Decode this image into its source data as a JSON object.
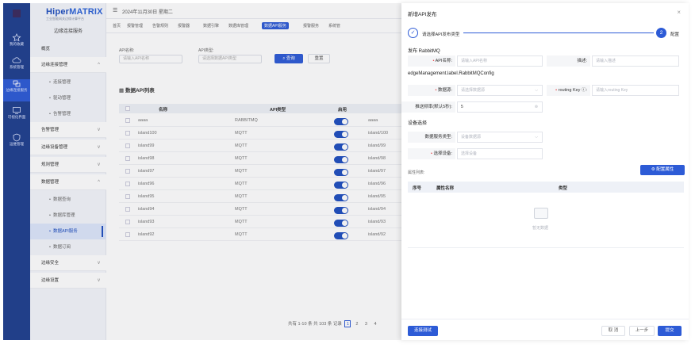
{
  "rail": {
    "items": [
      {
        "label": "我的收藏",
        "icon": "star-icon"
      },
      {
        "label": "系统管理",
        "icon": "cloud-icon"
      },
      {
        "label": "边缘连接服务",
        "icon": "link-icon"
      },
      {
        "label": "可视化界面",
        "icon": "monitor-icon"
      },
      {
        "label": "运维管理",
        "icon": "shield-icon"
      }
    ]
  },
  "brand": {
    "name_prefix": "Hiper",
    "name_suffix": "MATRIX",
    "subtitle": "工业智能网关边缘计算平台"
  },
  "sidebar": {
    "header": "边缘连接服务",
    "items": [
      {
        "label": "概览",
        "type": "plain"
      },
      {
        "label": "边缘连接管理",
        "type": "group",
        "chevron": "^"
      },
      {
        "label": "连接管理",
        "type": "sub"
      },
      {
        "label": "驱动管理",
        "type": "sub"
      },
      {
        "label": "告警管理",
        "type": "sub"
      },
      {
        "label": "告警管理",
        "type": "group",
        "chevron": "v"
      },
      {
        "label": "边缘设备管理",
        "type": "group",
        "chevron": "v"
      },
      {
        "label": "规则管理",
        "type": "group",
        "chevron": "v"
      },
      {
        "label": "数据管理",
        "type": "group",
        "chevron": "^"
      },
      {
        "label": "数据查询",
        "type": "sub"
      },
      {
        "label": "数据库管理",
        "type": "sub"
      },
      {
        "label": "数据API服务",
        "type": "sub",
        "current": true
      },
      {
        "label": "数据订阅",
        "type": "sub"
      },
      {
        "label": "边缘安全",
        "type": "group",
        "chevron": "v"
      },
      {
        "label": "边缘设置",
        "type": "group",
        "chevron": "v"
      }
    ]
  },
  "topbar": {
    "date": "2024年11月30日 星期二"
  },
  "tabs": [
    {
      "label": "首页"
    },
    {
      "label": "报警管理"
    },
    {
      "label": "告警规则"
    },
    {
      "label": "报警器"
    },
    {
      "label": "数据引擎"
    },
    {
      "label": "数据库管理"
    },
    {
      "label": "数据API服务",
      "active": true
    },
    {
      "label": "报警服务"
    },
    {
      "label": "系统管"
    }
  ],
  "filter": {
    "name_label": "API名称:",
    "name_placeholder": "请输入API名称",
    "type_label": "API类型:",
    "type_placeholder": "请选择数据API类型",
    "search_label": "查询",
    "reset_label": "重置"
  },
  "list": {
    "title": "数据API列表",
    "columns": [
      "名称",
      "API类型",
      "启用"
    ],
    "rows": [
      {
        "name": "aaaa",
        "type": "RABBITMQ",
        "extra": "aaaa"
      },
      {
        "name": "island100",
        "type": "MQTT",
        "extra": "island/100"
      },
      {
        "name": "island99",
        "type": "MQTT",
        "extra": "island/99"
      },
      {
        "name": "island98",
        "type": "MQTT",
        "extra": "island/98"
      },
      {
        "name": "island97",
        "type": "MQTT",
        "extra": "island/97"
      },
      {
        "name": "island96",
        "type": "MQTT",
        "extra": "island/96"
      },
      {
        "name": "island95",
        "type": "MQTT",
        "extra": "island/95"
      },
      {
        "name": "island94",
        "type": "MQTT",
        "extra": "island/94"
      },
      {
        "name": "island93",
        "type": "MQTT",
        "extra": "island/93"
      },
      {
        "name": "island92",
        "type": "MQTT",
        "extra": "island/92"
      }
    ],
    "pager_text": "共有 1-10 条 共 103 条 记录",
    "pages": [
      "1",
      "2",
      "3",
      "4"
    ]
  },
  "drawer": {
    "title": "新增API发布",
    "close": "×",
    "step1": "请选择API发布类型",
    "step2_num": "2",
    "step2": "配置",
    "section_publish": "发布 RabbitMQ",
    "api_name_label": "API名称:",
    "api_name_placeholder": "请输入API名称",
    "desc_label": "描述:",
    "desc_placeholder": "请输入描述",
    "section_config": "edgeManagement.label.RabbitMQConfig",
    "datasource_label": "数据源:",
    "datasource_placeholder": "请选择数据源",
    "routing_label": "routing Key",
    "routing_placeholder": "请输入routing Key",
    "freq_label": "推送频率(默认5秒):",
    "freq_value": "5",
    "section_device": "设备选择",
    "service_type_label": "数据服务类型:",
    "service_type_placeholder": "设备数据源",
    "device_label": "选择设备:",
    "device_placeholder": "选择设备",
    "attr_list_label": "属性列表:",
    "attr_button": "配置属性",
    "attr_columns": [
      "序号",
      "属性名称",
      "类型"
    ],
    "empty_text": "暂无数据",
    "test_button": "连接测试",
    "cancel_button": "取 消",
    "prev_button": "上一步",
    "submit_button": "提交"
  }
}
